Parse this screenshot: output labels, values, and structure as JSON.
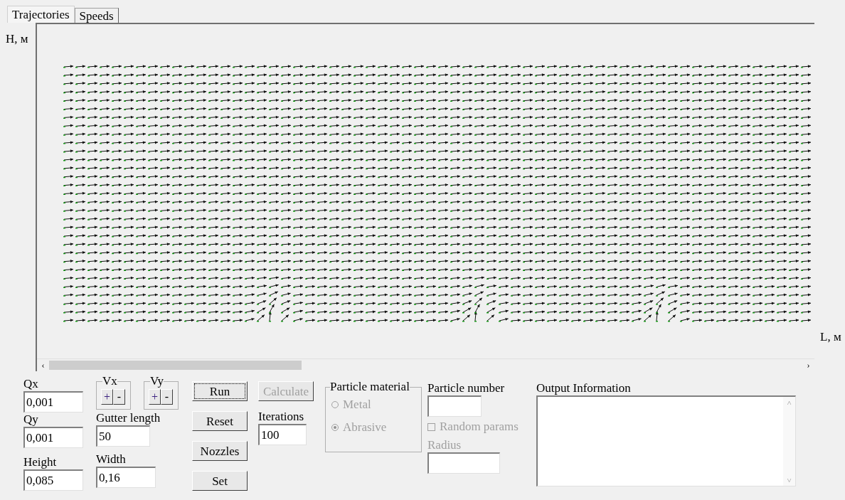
{
  "tabs": [
    {
      "label": "Trajectories",
      "selected": true
    },
    {
      "label": "Speeds",
      "selected": false
    }
  ],
  "plot": {
    "y_axis_label": "H, м",
    "x_axis_label": "L, м",
    "scroll_left": "‹",
    "scroll_right": "›"
  },
  "fields_left": [
    {
      "label": "Qx",
      "value": "0,001"
    },
    {
      "label": "Qy",
      "value": "0,001"
    },
    {
      "label": "Height",
      "value": "0,085"
    }
  ],
  "step_groups": [
    {
      "label": "Vx",
      "plus": "+",
      "minus": "-"
    },
    {
      "label": "Vy",
      "plus": "+",
      "minus": "-"
    }
  ],
  "gutter_length": {
    "label": "Gutter length",
    "value": "50"
  },
  "width": {
    "label": "Width",
    "value": "0,16"
  },
  "buttons": [
    {
      "label": "Run",
      "focused": true,
      "disabled": false
    },
    {
      "label": "Reset",
      "focused": false,
      "disabled": false
    },
    {
      "label": "Nozzles",
      "focused": false,
      "disabled": false
    },
    {
      "label": "Set",
      "focused": false,
      "disabled": false
    }
  ],
  "calculate_button": {
    "label": "Calculate",
    "disabled": true
  },
  "iterations": {
    "label": "Iterations",
    "value": "100"
  },
  "particle_material": {
    "title": "Particle material",
    "options": [
      {
        "label": "Metal",
        "selected": false,
        "disabled": true
      },
      {
        "label": "Abrasive",
        "selected": true,
        "disabled": true
      }
    ]
  },
  "particle_number": {
    "label": "Particle number"
  },
  "random_params": {
    "label": "Random params",
    "checked": false,
    "disabled": true
  },
  "radius": {
    "label": "Radius",
    "disabled": true
  },
  "output": {
    "label": "Output Information",
    "scroll_up": "˄",
    "scroll_down": "˅"
  }
}
